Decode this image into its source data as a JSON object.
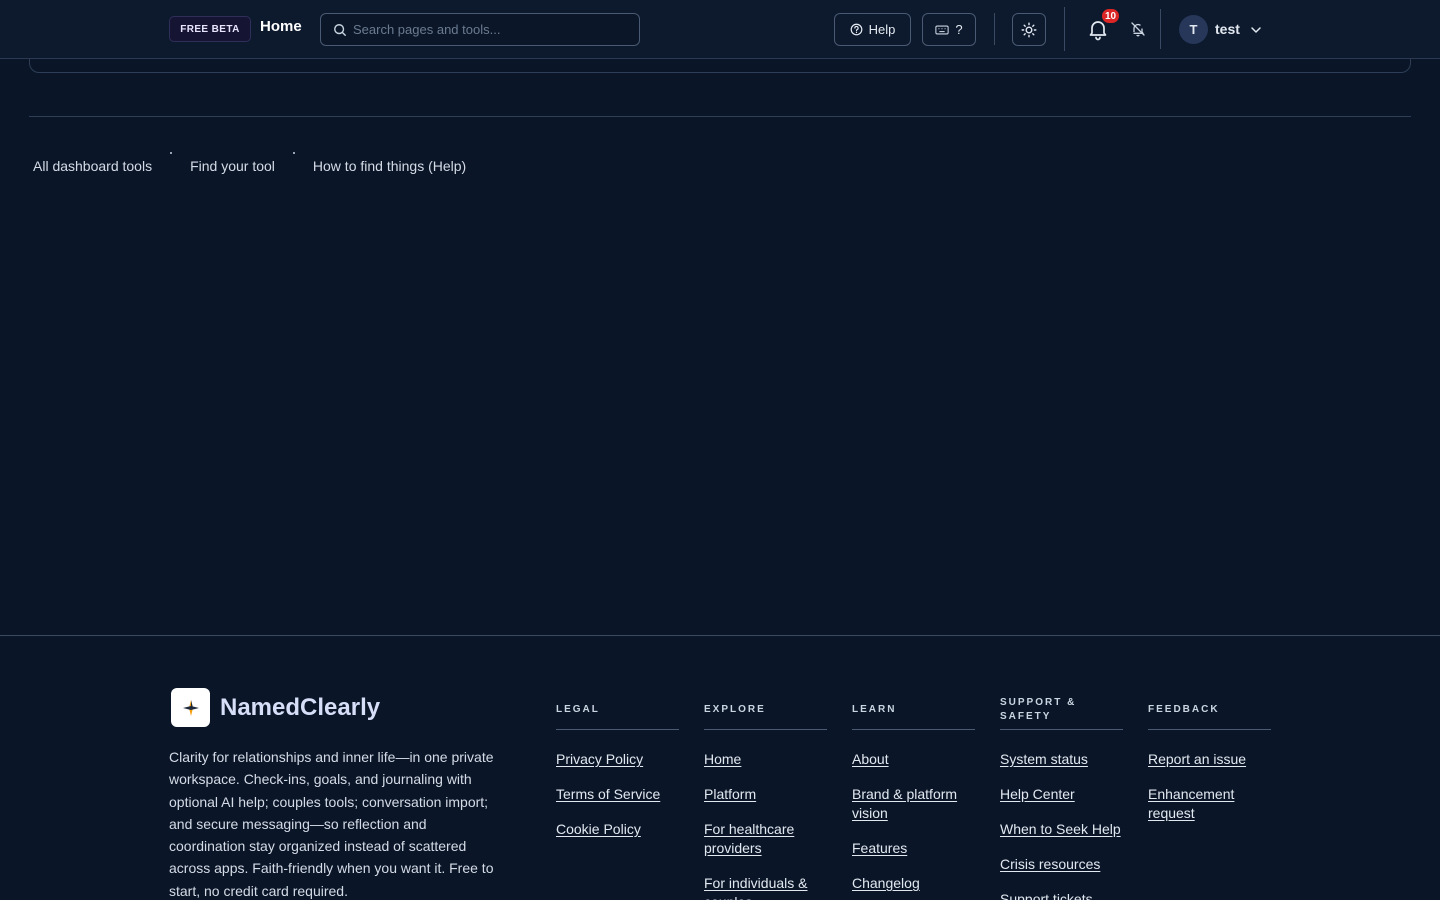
{
  "header": {
    "beta_label": "FREE BETA",
    "title": "Home",
    "search_placeholder": "Search pages and tools...",
    "help_label": "Help",
    "shortcuts_label": "?",
    "notifications_count": "10",
    "avatar_initial": "T",
    "username": "test",
    "icons": [
      "search-icon",
      "help-circle-icon",
      "keyboard-icon",
      "sun-icon",
      "bell-icon",
      "bell-off-icon",
      "chevron-down-icon"
    ]
  },
  "quick_links": [
    "All dashboard tools",
    "Find your tool",
    "How to find things (Help)"
  ],
  "footer": {
    "brand": "NamedClearly",
    "tagline": "Clarity for relationships and inner life—in one private workspace. Check-ins, goals, and journaling with optional AI help; couples tools; conversation import; and secure messaging—so reflection and coordination stay organized instead of scattered across apps. Faith-friendly when you want it. Free to start, no credit card required.",
    "columns": [
      {
        "heading": "LEGAL",
        "links": [
          "Privacy Policy",
          "Terms of Service",
          "Cookie Policy"
        ]
      },
      {
        "heading": "EXPLORE",
        "links": [
          "Home",
          "Platform",
          "For healthcare providers",
          "For individuals & couples"
        ]
      },
      {
        "heading": "LEARN",
        "links": [
          "About",
          "Brand & platform vision",
          "Features",
          "Changelog"
        ]
      },
      {
        "heading": "SUPPORT & SAFETY",
        "links": [
          "System status",
          "Help Center",
          "When to Seek Help",
          "Crisis resources",
          "Support tickets"
        ]
      },
      {
        "heading": "FEEDBACK",
        "links": [
          "Report an issue",
          "Enhancement request"
        ]
      }
    ]
  },
  "colors": {
    "background": "#0a1628",
    "header_bg": "#0d1a2d",
    "badge": "#dc2626",
    "brand_text": "#d7def8"
  }
}
